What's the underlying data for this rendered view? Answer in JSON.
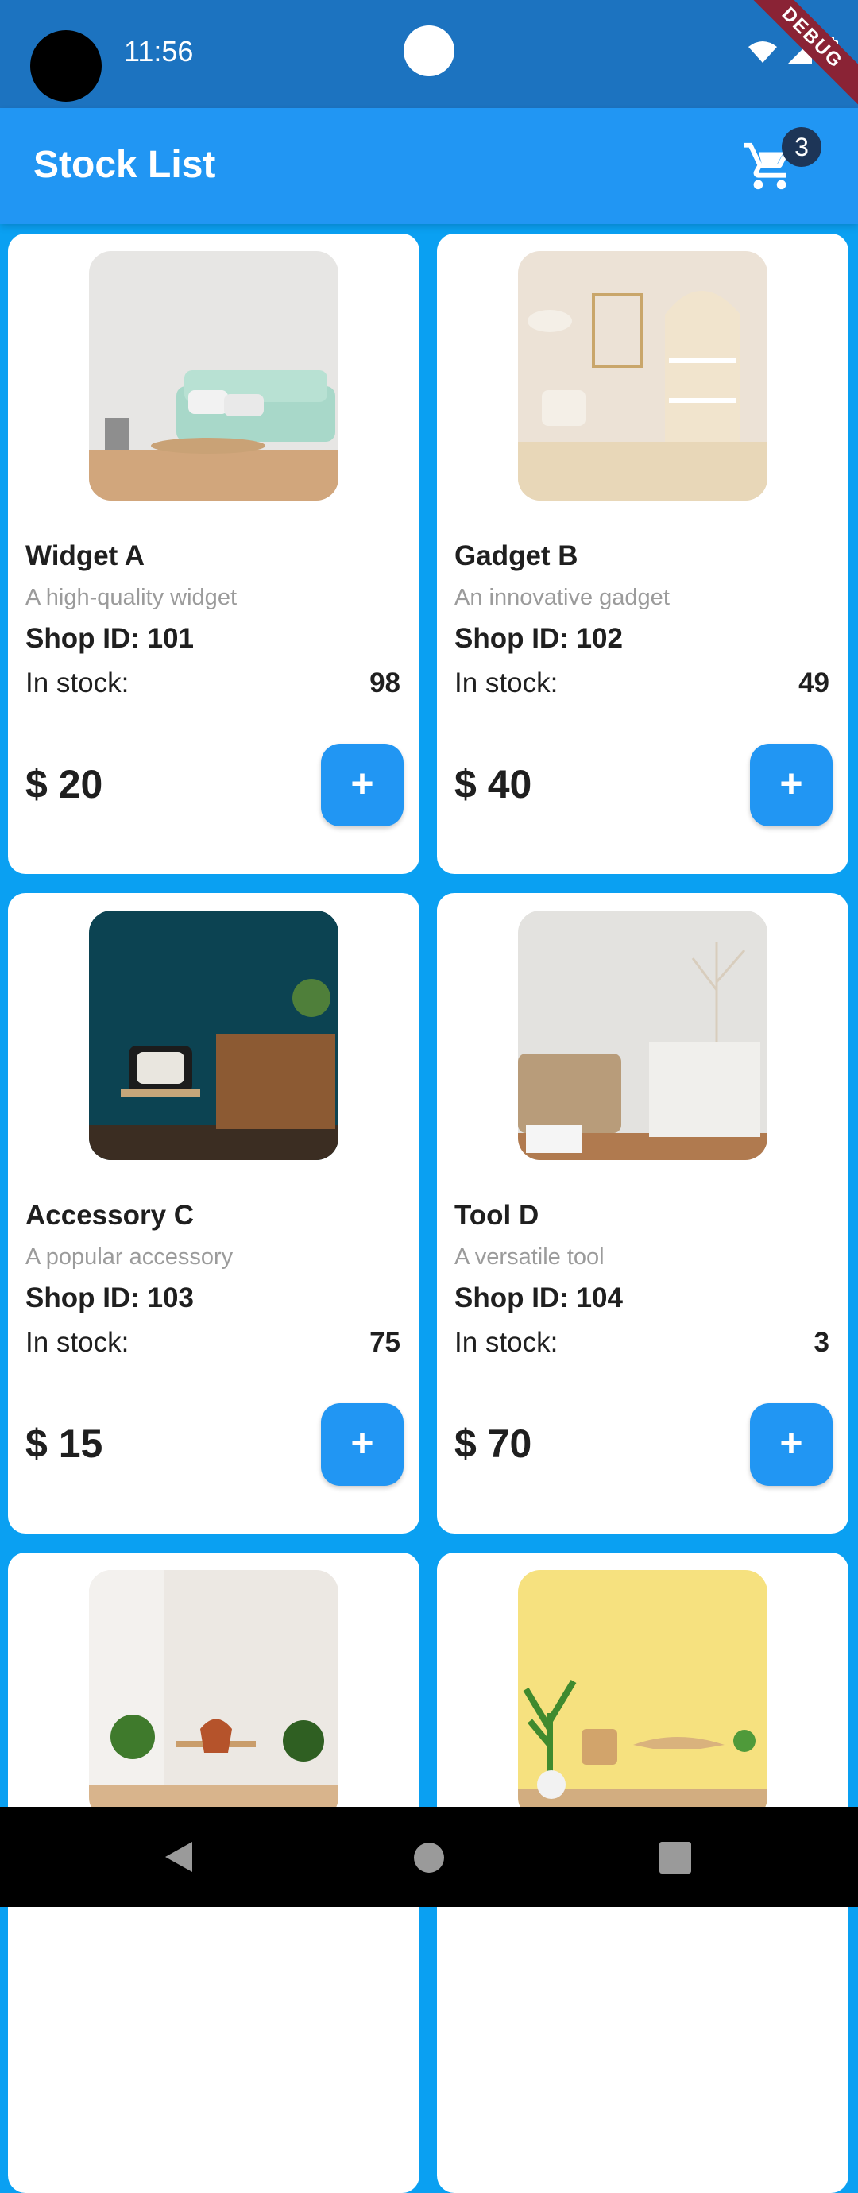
{
  "status": {
    "time": "11:56",
    "debug_label": "DEBUG"
  },
  "appbar": {
    "title": "Stock List",
    "cart_count": "3"
  },
  "products": [
    {
      "name": "Widget A",
      "description": "A high-quality widget",
      "shop": "Shop ID: 101",
      "stock_label": "In stock:",
      "stock": "98",
      "price": "$ 20",
      "add_label": "+"
    },
    {
      "name": "Gadget B",
      "description": "An innovative gadget",
      "shop": "Shop ID: 102",
      "stock_label": "In stock:",
      "stock": "49",
      "price": "$ 40",
      "add_label": "+"
    },
    {
      "name": "Accessory C",
      "description": "A popular accessory",
      "shop": "Shop ID: 103",
      "stock_label": "In stock:",
      "stock": "75",
      "price": "$ 15",
      "add_label": "+"
    },
    {
      "name": "Tool D",
      "description": "A versatile tool",
      "shop": "Shop ID: 104",
      "stock_label": "In stock:",
      "stock": "3",
      "price": "$ 70",
      "add_label": "+"
    }
  ],
  "colors": {
    "primary": "#2196f3",
    "background": "#0aa0f2",
    "status_bar": "#1c73c0"
  },
  "icons": [
    "cart-icon",
    "wifi-icon",
    "signal-icon",
    "battery-icon",
    "back-icon",
    "home-icon",
    "recents-icon"
  ]
}
